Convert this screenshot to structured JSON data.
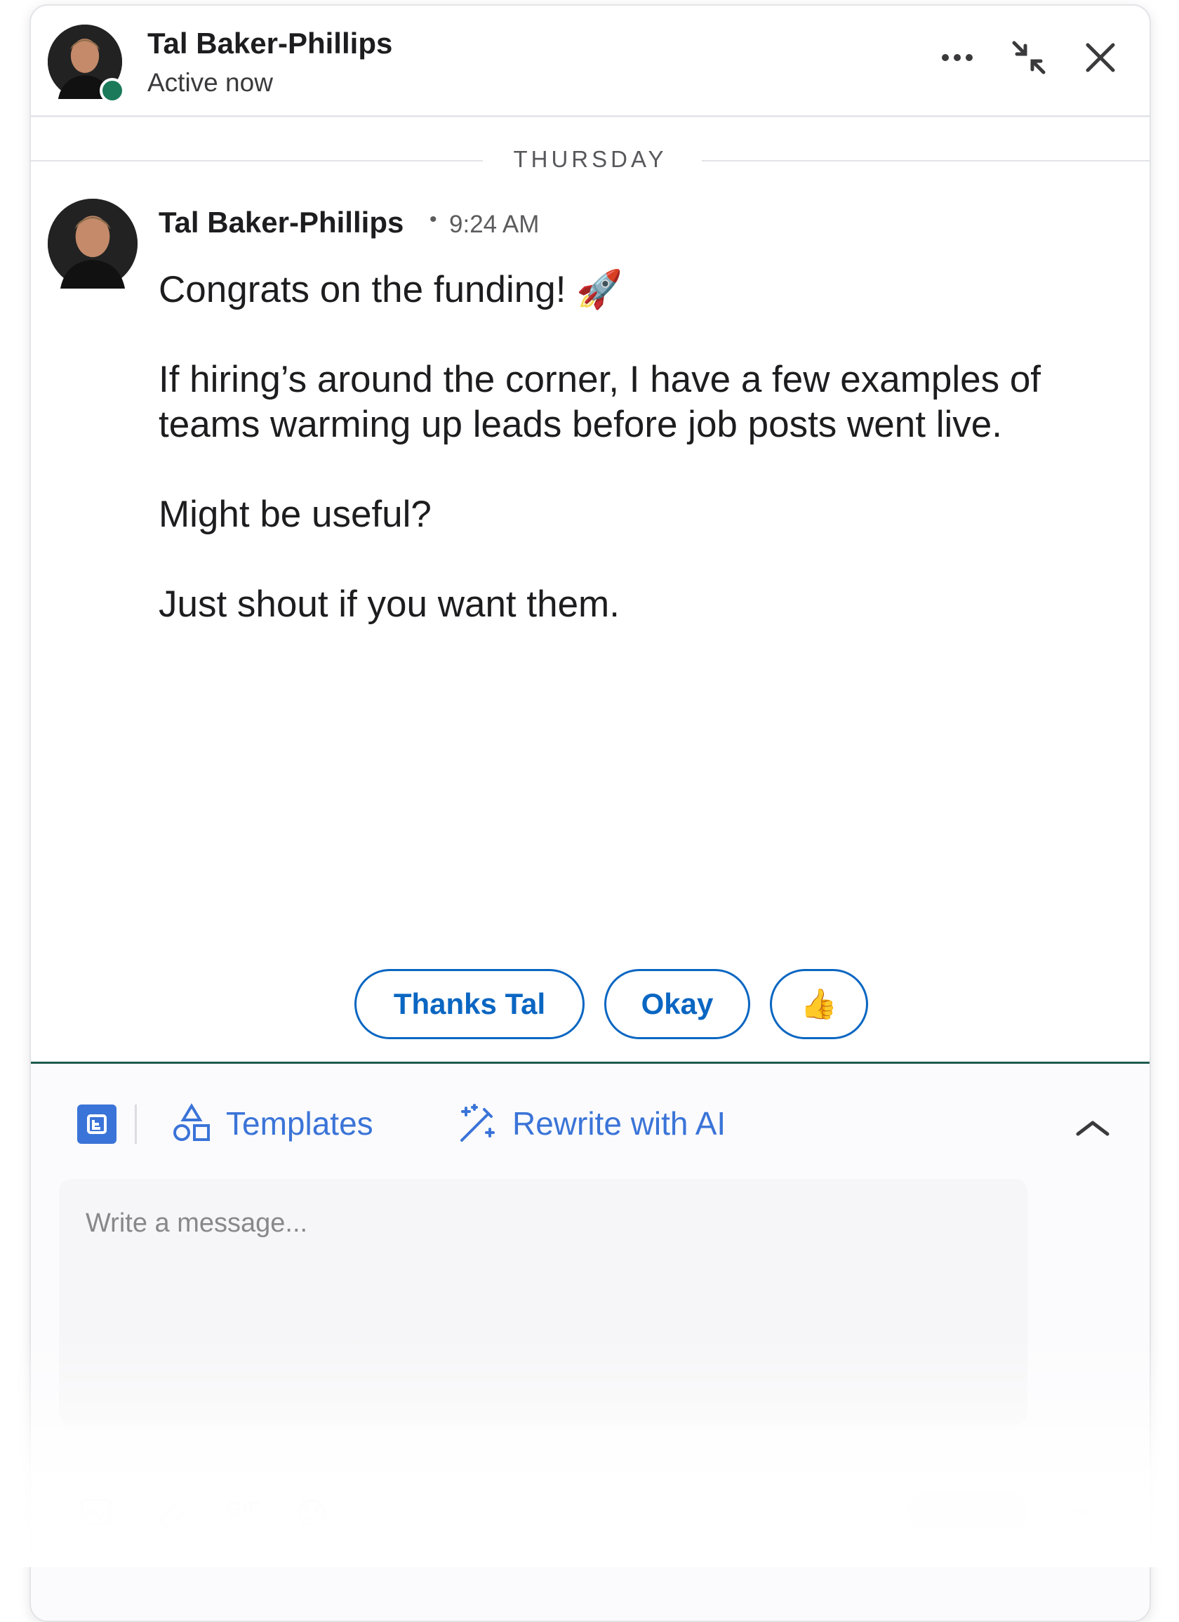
{
  "header": {
    "contact_name": "Tal Baker-Phillips",
    "status": "Active now",
    "presence_color": "#1a7a5a",
    "actions": [
      "more-icon",
      "minimize-icon",
      "close-icon"
    ]
  },
  "conversation": {
    "day_label": "THURSDAY",
    "message": {
      "sender": "Tal Baker-Phillips",
      "separator": "•",
      "time": "9:24 AM",
      "paragraphs": [
        "Congrats on the funding! 🚀",
        "If hiring’s around the corner, I have a few examples of teams warming up leads before job posts went live.",
        "Might be useful?",
        "Just shout if you want them."
      ]
    }
  },
  "quick_replies": [
    "Thanks Tal",
    "Okay",
    "👍"
  ],
  "composer": {
    "templates_label": "Templates",
    "rewrite_label": "Rewrite with AI",
    "placeholder": "Write a message...",
    "gif_label": "GIF"
  },
  "colors": {
    "accent": "#0a66c2",
    "tool_accent": "#3b74d8",
    "composer_border": "#1f5b4f"
  }
}
